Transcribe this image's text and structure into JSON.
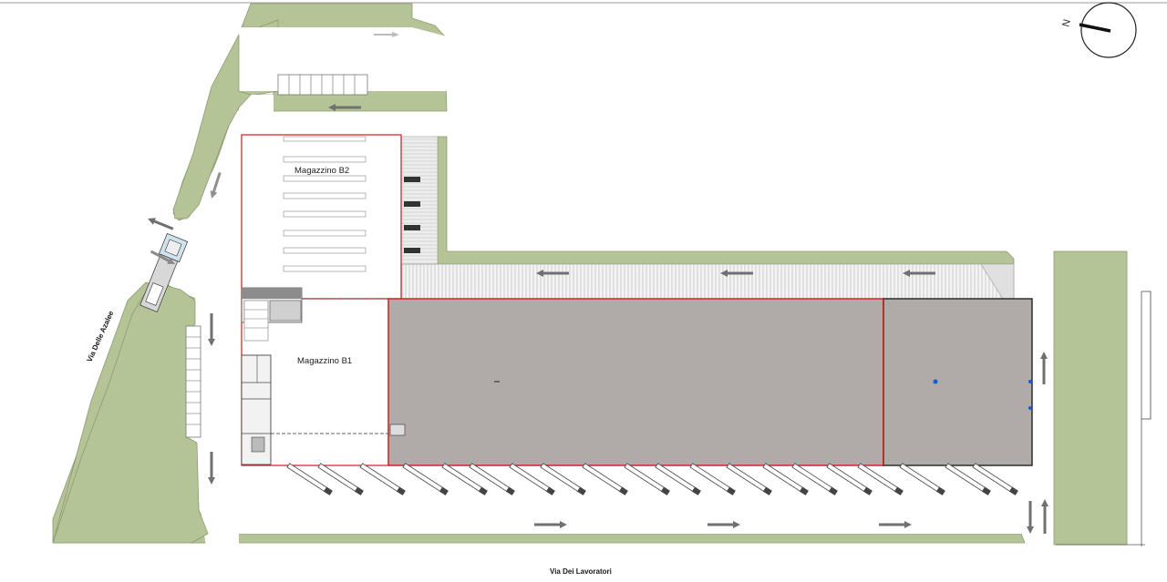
{
  "plan": {
    "buildings": {
      "warehouse_b2": "Magazzino B2",
      "warehouse_b1": "Magazzino B1"
    },
    "streets": {
      "south": "Via Dei Lavoratori",
      "west": "Via Delle Azalee"
    },
    "compass": {
      "north_label": "N"
    },
    "colors": {
      "green_area": "#b5c496",
      "roof": "#b0aaa8",
      "outline_red": "#d21a1a",
      "arrow": "#707070",
      "truck": "#555555"
    },
    "icons": [
      "compass-icon",
      "arrow-icon",
      "truck-icon",
      "parking-stall"
    ]
  }
}
